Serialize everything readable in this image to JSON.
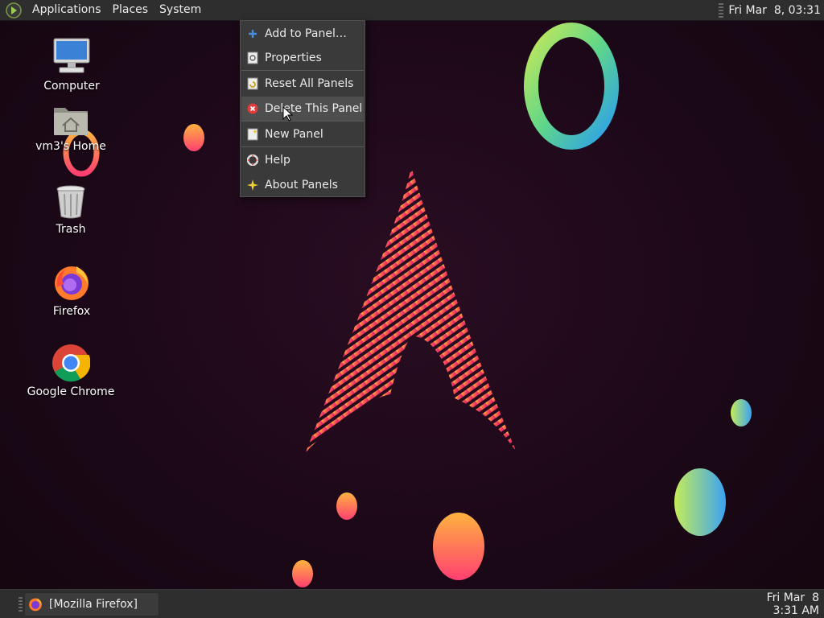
{
  "top_panel": {
    "menus": [
      "Applications",
      "Places",
      "System"
    ],
    "clock": "Fri Mar  8, 03:31"
  },
  "desktop_icons": [
    {
      "label": "Computer",
      "icon": "computer-icon"
    },
    {
      "label": "vm3's Home",
      "icon": "home-folder-icon"
    },
    {
      "label": "Trash",
      "icon": "trash-icon"
    },
    {
      "label": "Firefox",
      "icon": "firefox-icon"
    },
    {
      "label": "Google Chrome",
      "icon": "chrome-icon"
    }
  ],
  "context_menu": {
    "items": [
      {
        "label": "Add to Panel…",
        "icon": "plus-icon"
      },
      {
        "label": "Properties",
        "icon": "properties-icon"
      },
      {
        "label": "Reset All Panels",
        "icon": "reset-icon"
      },
      {
        "label": "Delete This Panel",
        "icon": "delete-icon",
        "highlighted": true
      },
      {
        "label": "New Panel",
        "icon": "new-panel-icon"
      },
      {
        "label": "Help",
        "icon": "help-icon"
      },
      {
        "label": "About Panels",
        "icon": "about-icon"
      }
    ]
  },
  "taskbar": {
    "window_button": "[Mozilla Firefox]",
    "clock_date": "Fri Mar  8",
    "clock_time": "3:31 AM"
  },
  "colors": {
    "panel": "#2e2e2e",
    "menu": "#3a3a3a",
    "menu_highlight": "#4e4e4e",
    "wallpaper": "#1c0818",
    "arch_pink": "#e8336e"
  }
}
